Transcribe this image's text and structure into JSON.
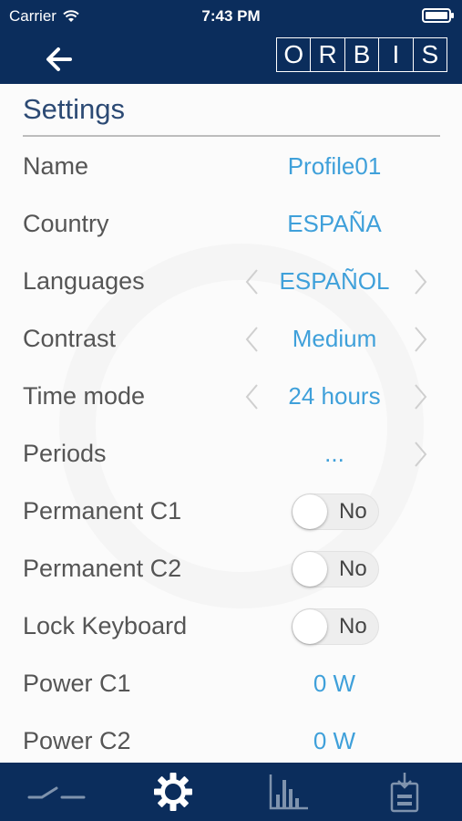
{
  "status_bar": {
    "carrier": "Carrier",
    "time": "7:43 PM"
  },
  "navbar": {
    "logo_letters": [
      "O",
      "R",
      "B",
      "I",
      "S"
    ]
  },
  "settings": {
    "title": "Settings",
    "name": {
      "label": "Name",
      "value": "Profile01"
    },
    "country": {
      "label": "Country",
      "value": "ESPAÑA"
    },
    "languages": {
      "label": "Languages",
      "value": "ESPAÑOL"
    },
    "contrast": {
      "label": "Contrast",
      "value": "Medium"
    },
    "time_mode": {
      "label": "Time mode",
      "value": "24 hours"
    },
    "periods": {
      "label": "Periods",
      "value": "..."
    },
    "permanent_c1": {
      "label": "Permanent C1",
      "value": "No"
    },
    "permanent_c2": {
      "label": "Permanent C2",
      "value": "No"
    },
    "lock_keyboard": {
      "label": "Lock Keyboard",
      "value": "No"
    },
    "power_c1": {
      "label": "Power C1",
      "value": "0 W"
    },
    "power_c2": {
      "label": "Power C2",
      "value": "0 W"
    }
  },
  "tabbar": {
    "tabs": [
      {
        "icon": "switch-icon",
        "active": false
      },
      {
        "icon": "gear-icon",
        "active": true
      },
      {
        "icon": "bar-chart-icon",
        "active": false
      },
      {
        "icon": "download-device-icon",
        "active": false
      }
    ]
  },
  "colors": {
    "navy": "#0b2d5c",
    "accent": "#3fa0da",
    "label": "#555555",
    "title": "#2c4a74"
  }
}
